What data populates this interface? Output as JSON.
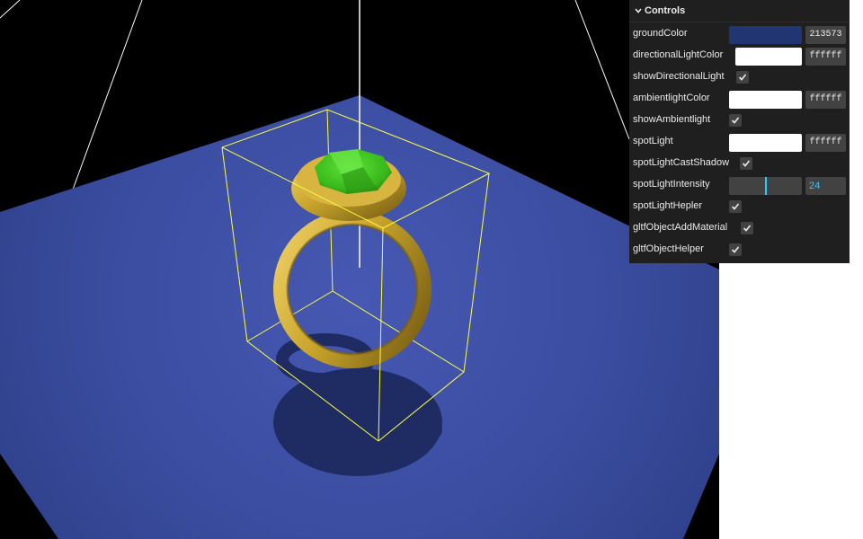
{
  "gui": {
    "title": "Controls",
    "controls": {
      "groundColor": {
        "label": "groundColor",
        "hex": "213573",
        "color": "#213573"
      },
      "directionalLightColor": {
        "label": "directionalLightColor",
        "hex": "ffffff",
        "color": "#ffffff"
      },
      "showDirectionalLight": {
        "label": "showDirectionalLight",
        "checked": true
      },
      "ambientlightColor": {
        "label": "ambientlightColor",
        "hex": "ffffff",
        "color": "#ffffff"
      },
      "showAmbientlight": {
        "label": "showAmbientlight",
        "checked": true
      },
      "spotLight": {
        "label": "spotLight",
        "hex": "ffffff",
        "color": "#ffffff"
      },
      "spotLightCastShadow": {
        "label": "spotLightCastShadow",
        "checked": true
      },
      "spotLightIntensity": {
        "label": "spotLightIntensity",
        "value": "24",
        "fraction": 0.5
      },
      "spotLightHepler": {
        "label": "spotLightHepler",
        "checked": true
      },
      "gltfObjectAddMaterial": {
        "label": "gltfObjectAddMaterial",
        "checked": true
      },
      "gltfObjectHelper": {
        "label": "gltfObjectHelper",
        "checked": true
      }
    }
  },
  "scene": {
    "background": "#000000",
    "ground_color": "#3d4fa3",
    "ring_color": "#c9a52c",
    "gem_color": "#3fc21f",
    "box_helper_color": "#ffff40",
    "spotlight_helper_color": "#ffffff"
  }
}
